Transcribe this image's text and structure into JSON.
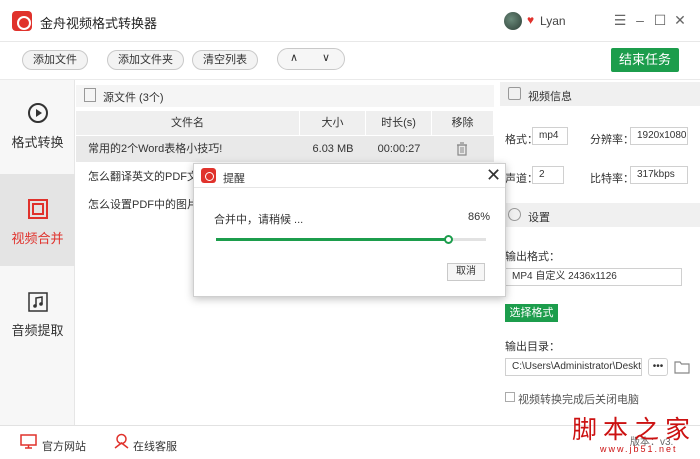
{
  "app": {
    "title": "金舟视频格式转换器",
    "username": "Lyan",
    "accent": "#e0322c",
    "green": "#1c9d4c"
  },
  "toolbar": {
    "add_file": "添加文件",
    "add_folder": "添加文件夹",
    "clear_list": "清空列表",
    "up_arrow": "∧",
    "down_arrow": "∨",
    "end_task": "结束任务"
  },
  "sidebar": {
    "items": [
      {
        "label": "格式转换",
        "icon": "play-circle-icon"
      },
      {
        "label": "视频合并",
        "icon": "merge-icon"
      },
      {
        "label": "音频提取",
        "icon": "music-icon"
      }
    ]
  },
  "files": {
    "header": "源文件 (3个)",
    "columns": [
      "文件名",
      "大小",
      "时长(s)",
      "移除"
    ],
    "rows": [
      {
        "name": "常用的2个Word表格小技巧!",
        "size": "6.03 MB",
        "duration": "00:00:27"
      },
      {
        "name": "怎么翻译英文的PDF文档",
        "size": "",
        "duration": ""
      },
      {
        "name": "怎么设置PDF中的图片大",
        "size": "",
        "duration": ""
      }
    ]
  },
  "info": {
    "video_info_title": "视频信息",
    "format_label": "格式：",
    "format_value": "mp4",
    "resolution_label": "分辨率：",
    "resolution_value": "1920x1080",
    "channel_label": "声道：",
    "channel_value": "2",
    "bitrate_label": "比特率：",
    "bitrate_value": "317kbps",
    "settings_title": "设置",
    "output_format_label": "输出格式：",
    "output_format_value": "MP4 自定义 2436x1126",
    "choose_format": "选择格式",
    "output_dir_label": "输出目录：",
    "output_dir_value": "C:\\Users\\Administrator\\Deskto",
    "browse": "•••",
    "shutdown_label": "视频转换完成后关闭电脑"
  },
  "bottom": {
    "official_site": "官方网站",
    "online_service": "在线客服",
    "version": "版本：v3.",
    "watermark": "脚本之家",
    "watermark_url": "www.jb51.net"
  },
  "dialog": {
    "title": "提醒",
    "message": "合并中，请稍候 ...",
    "percent_text": "86%",
    "progress": 0.86,
    "cancel": "取消"
  }
}
